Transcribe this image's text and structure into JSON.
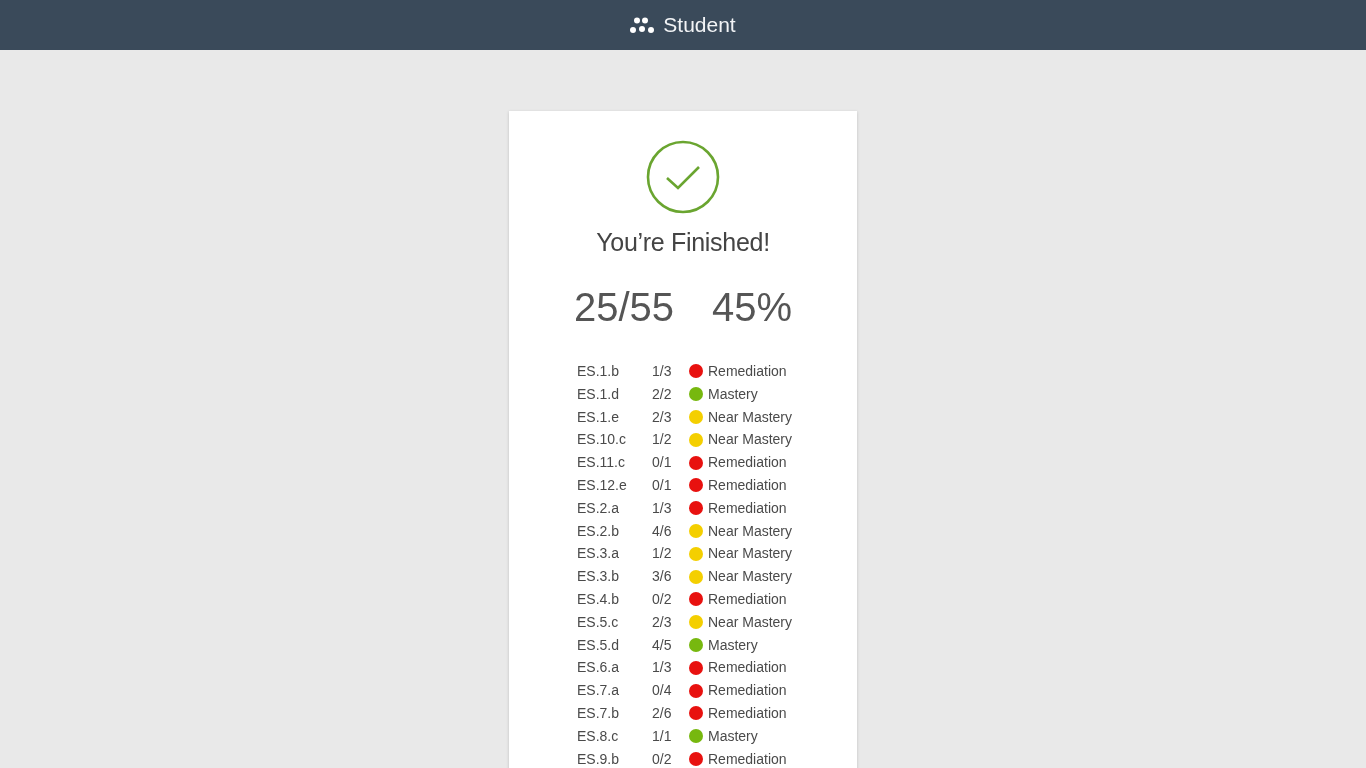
{
  "header": {
    "title": "Student"
  },
  "result": {
    "heading": "You’re Finished!",
    "score": "25/55",
    "percent": "45%"
  },
  "standards": [
    {
      "code": "ES.1.b",
      "score": "1/3",
      "status": "Remediation",
      "color": "#e8110f"
    },
    {
      "code": "ES.1.d",
      "score": "2/2",
      "status": "Mastery",
      "color": "#77b80f"
    },
    {
      "code": "ES.1.e",
      "score": "2/3",
      "status": "Near Mastery",
      "color": "#f4cf00"
    },
    {
      "code": "ES.10.c",
      "score": "1/2",
      "status": "Near Mastery",
      "color": "#f4cf00"
    },
    {
      "code": "ES.11.c",
      "score": "0/1",
      "status": "Remediation",
      "color": "#e8110f"
    },
    {
      "code": "ES.12.e",
      "score": "0/1",
      "status": "Remediation",
      "color": "#e8110f"
    },
    {
      "code": "ES.2.a",
      "score": "1/3",
      "status": "Remediation",
      "color": "#e8110f"
    },
    {
      "code": "ES.2.b",
      "score": "4/6",
      "status": "Near Mastery",
      "color": "#f4cf00"
    },
    {
      "code": "ES.3.a",
      "score": "1/2",
      "status": "Near Mastery",
      "color": "#f4cf00"
    },
    {
      "code": "ES.3.b",
      "score": "3/6",
      "status": "Near Mastery",
      "color": "#f4cf00"
    },
    {
      "code": "ES.4.b",
      "score": "0/2",
      "status": "Remediation",
      "color": "#e8110f"
    },
    {
      "code": "ES.5.c",
      "score": "2/3",
      "status": "Near Mastery",
      "color": "#f4cf00"
    },
    {
      "code": "ES.5.d",
      "score": "4/5",
      "status": "Mastery",
      "color": "#77b80f"
    },
    {
      "code": "ES.6.a",
      "score": "1/3",
      "status": "Remediation",
      "color": "#e8110f"
    },
    {
      "code": "ES.7.a",
      "score": "0/4",
      "status": "Remediation",
      "color": "#e8110f"
    },
    {
      "code": "ES.7.b",
      "score": "2/6",
      "status": "Remediation",
      "color": "#e8110f"
    },
    {
      "code": "ES.8.c",
      "score": "1/1",
      "status": "Mastery",
      "color": "#77b80f"
    },
    {
      "code": "ES.9.b",
      "score": "0/2",
      "status": "Remediation",
      "color": "#e8110f"
    }
  ]
}
